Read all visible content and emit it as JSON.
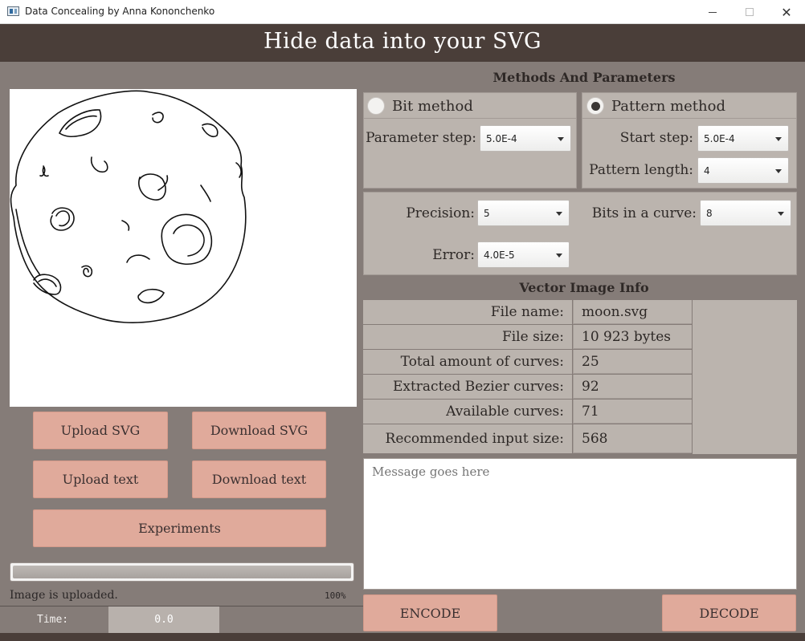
{
  "window": {
    "title": "Data Concealing by Anna Kononchenko",
    "close_glyph": "✕"
  },
  "header": {
    "title": "Hide data into your SVG"
  },
  "left": {
    "buttons": {
      "upload_svg": "Upload SVG",
      "download_svg": "Download SVG",
      "upload_text": "Upload text",
      "download_text": "Download text",
      "experiments": "Experiments"
    },
    "progress": {
      "value": 1.0
    },
    "status_text": "Image is uploaded.",
    "status_percent": "100%",
    "time_label": "Time:",
    "time_value": "0.0"
  },
  "methods": {
    "title": "Methods And Parameters",
    "bit_method": {
      "label": "Bit method",
      "checked": false
    },
    "pattern_method": {
      "label": "Pattern method",
      "checked": true
    },
    "parameter_step": {
      "label": "Parameter step:",
      "value": "5.0E-4"
    },
    "start_step": {
      "label": "Start step:",
      "value": "5.0E-4"
    },
    "pattern_length": {
      "label": "Pattern length:",
      "value": "4"
    },
    "precision": {
      "label": "Precision:",
      "value": "5"
    },
    "bits_in_curve": {
      "label": "Bits in a curve:",
      "value": "8"
    },
    "error": {
      "label": "Error:",
      "value": "4.0E-5"
    }
  },
  "vector_info": {
    "title": "Vector Image Info",
    "rows": [
      {
        "key": "File name:",
        "value": "moon.svg"
      },
      {
        "key": "File size:",
        "value": "10 923 bytes"
      },
      {
        "key": "Total amount of curves:",
        "value": "25"
      },
      {
        "key": "Extracted Bezier curves:",
        "value": "92"
      },
      {
        "key": "Available curves:",
        "value": "71"
      },
      {
        "key": "Recommended input size:",
        "value": "568"
      }
    ]
  },
  "message": {
    "placeholder": "Message goes here",
    "value": ""
  },
  "actions": {
    "encode": "ENCODE",
    "decode": "DECODE"
  }
}
